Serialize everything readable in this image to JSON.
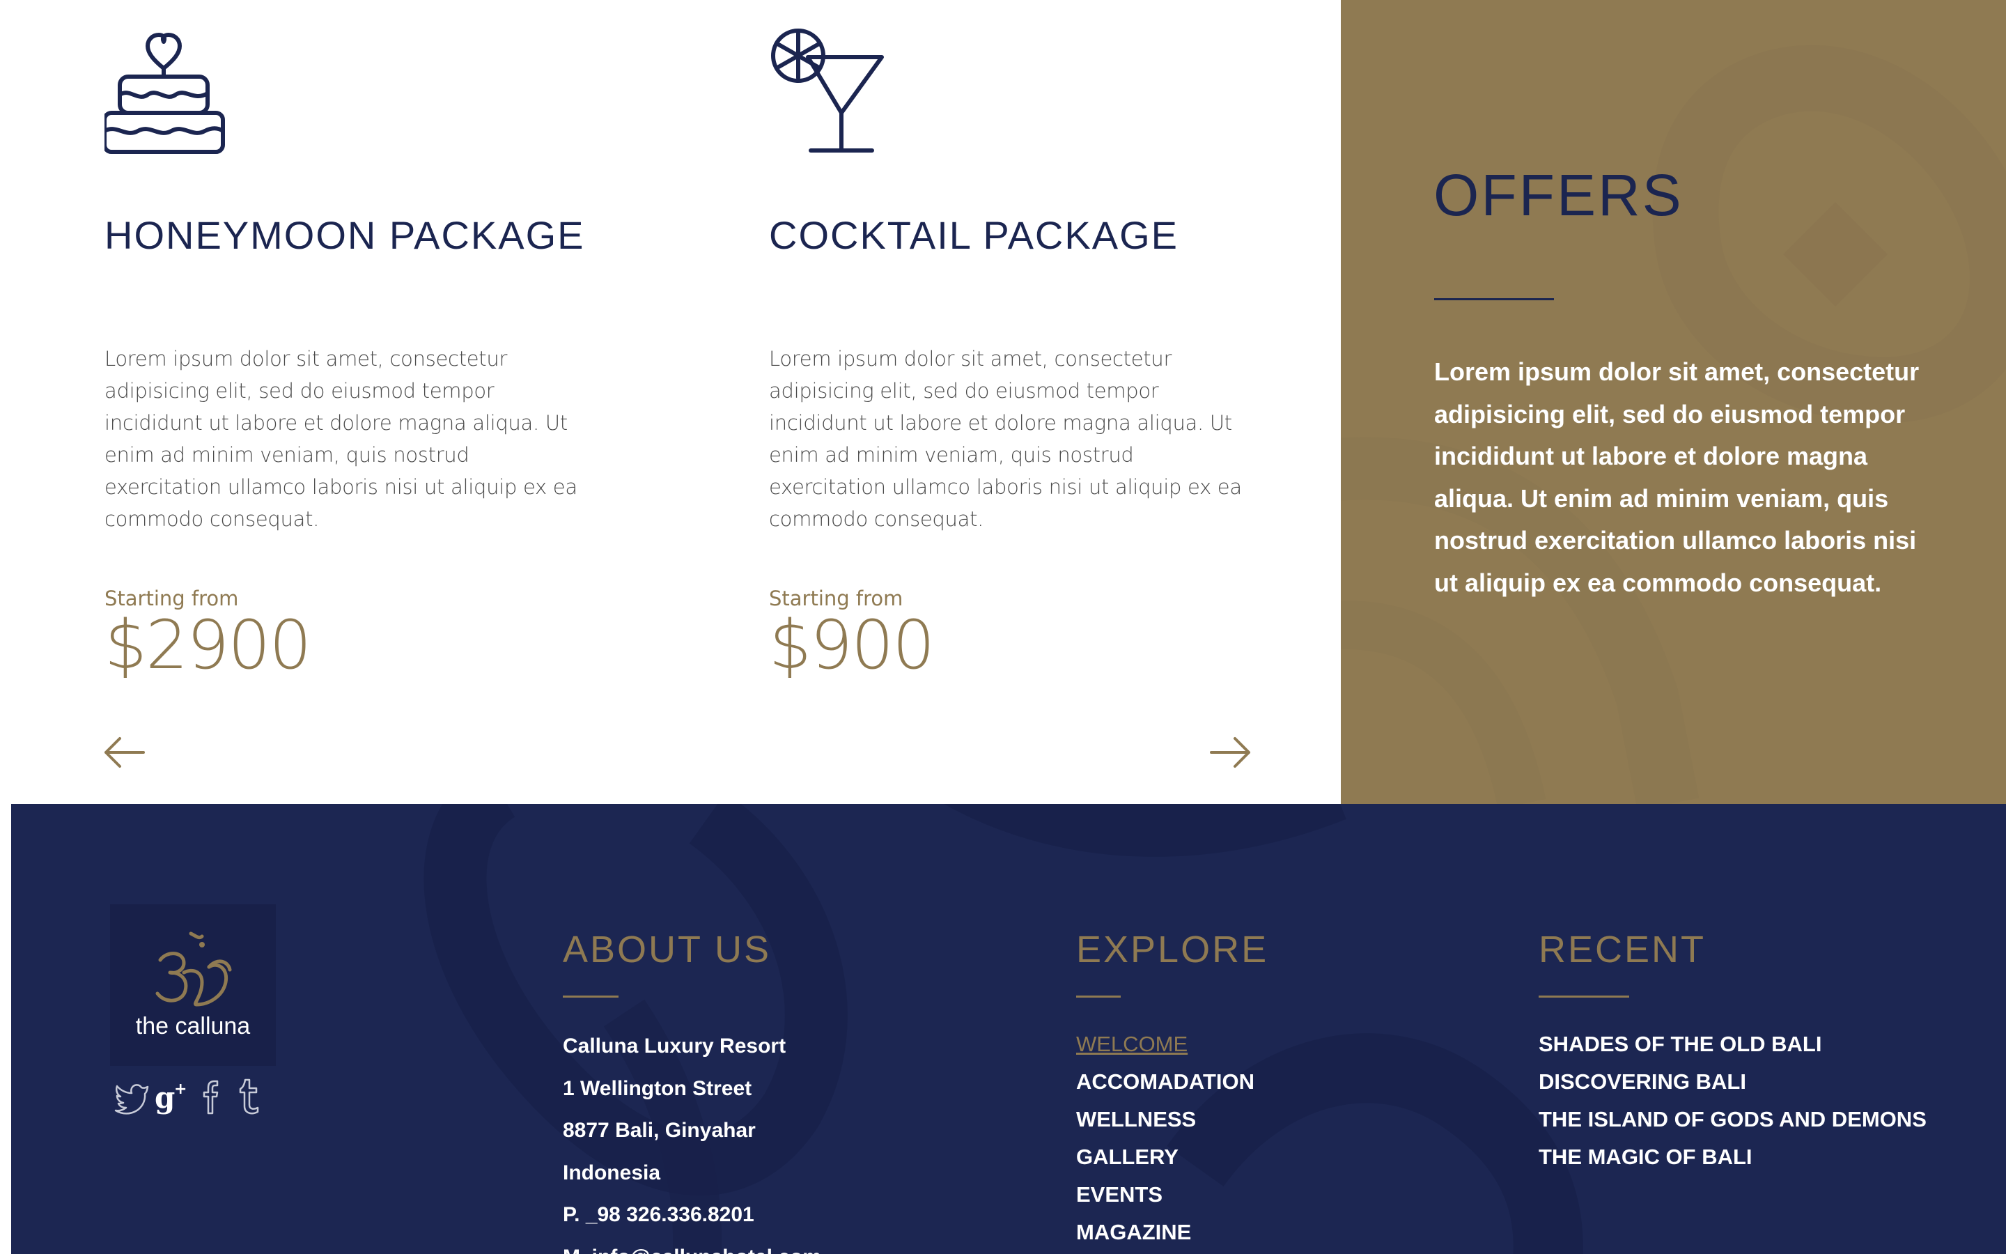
{
  "packages": [
    {
      "icon": "cake-icon",
      "title": "HONEYMOON PACKAGE",
      "description": "Lorem ipsum dolor sit amet, consectetur adipisicing elit, sed do eiusmod tempor incididunt ut labore et dolore magna aliqua. Ut enim ad minim veniam, quis nostrud exercitation ullamco laboris nisi ut aliquip ex ea commodo consequat.",
      "starting_from": "Starting from",
      "price": "$2900"
    },
    {
      "icon": "cocktail-icon",
      "title": "COCKTAIL PACKAGE",
      "description": "Lorem ipsum dolor sit amet, consectetur adipisicing elit, sed do eiusmod tempor incididunt ut labore et dolore magna aliqua. Ut enim ad minim veniam, quis nostrud exercitation ullamco laboris nisi ut aliquip ex ea commodo consequat.",
      "starting_from": "Starting from",
      "price": "$900"
    }
  ],
  "carousel": {
    "prev_icon": "arrow-left-icon",
    "next_icon": "arrow-right-icon"
  },
  "offers": {
    "title": "OFFERS",
    "text": "Lorem ipsum dolor sit amet, consectetur adipisicing elit, sed do eiusmod tempor incididunt ut labore et dolore magna aliqua. Ut enim ad minim veniam, quis nostrud exercitation ullamco laboris nisi ut aliquip ex ea commodo consequat."
  },
  "footer": {
    "logo": {
      "icon": "om-icon",
      "text": "the calluna"
    },
    "social": [
      "twitter-icon",
      "google-plus-icon",
      "facebook-icon",
      "tumblr-icon"
    ],
    "about": {
      "heading": "ABOUT US",
      "lines": [
        "Calluna Luxury Resort",
        "1 Wellington Street",
        "8877 Bali, Ginyahar",
        "Indonesia",
        "P. _98 326.336.8201",
        "M. info@callunahotel.com"
      ]
    },
    "explore": {
      "heading": "EXPLORE",
      "links": [
        "WELCOME",
        "ACCOMADATION",
        "WELLNESS",
        "GALLERY",
        "EVENTS",
        "MAGAZINE"
      ],
      "active": "WELCOME"
    },
    "recent": {
      "heading": "RECENT",
      "links": [
        "SHADES OF THE OLD BALI",
        "DISCOVERING BALI",
        "THE ISLAND OF GODS AND DEMONS",
        "THE MAGIC OF BALI"
      ]
    }
  },
  "colors": {
    "navy": "#1b2550",
    "gold": "#8f7a52",
    "footer_bg": "#1c2652",
    "white": "#ffffff"
  }
}
